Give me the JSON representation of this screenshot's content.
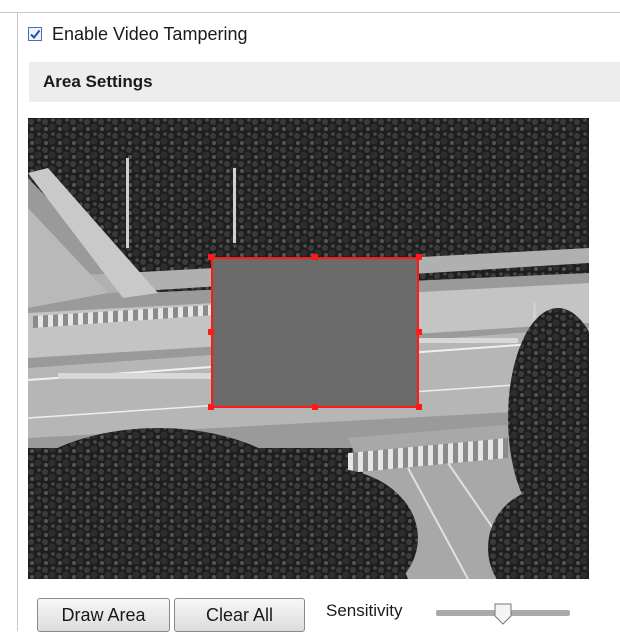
{
  "enable": {
    "label": "Enable Video Tampering",
    "checked": true
  },
  "section": {
    "title": "Area Settings"
  },
  "video": {
    "mask_color": "#6b6b6b",
    "outline_color": "#ff1a1a"
  },
  "controls": {
    "draw_area_label": "Draw Area",
    "clear_all_label": "Clear All",
    "sensitivity_label": "Sensitivity",
    "sensitivity_level": 0.5
  }
}
